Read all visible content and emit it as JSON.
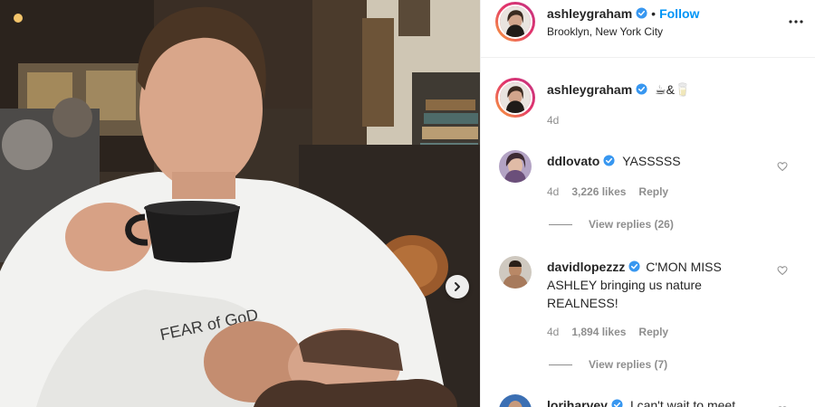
{
  "post": {
    "author": "ashleygraham",
    "follow_label": "Follow",
    "separator": "•",
    "location": "Brooklyn, New York City"
  },
  "caption": {
    "author": "ashleygraham",
    "text": "☕&🥛",
    "time": "4d"
  },
  "comments": [
    {
      "user": "ddlovato",
      "text": "YASSSSS",
      "time": "4d",
      "likes": "3,226 likes",
      "reply_label": "Reply",
      "view_replies": "View replies (26)"
    },
    {
      "user": "davidlopezzz",
      "text": "C'MON MISS ASHLEY bringing us nature REALNESS!",
      "time": "4d",
      "likes": "1,894 likes",
      "reply_label": "Reply",
      "view_replies": "View replies (7)"
    },
    {
      "user": "loriharvey",
      "text": "I can't wait to meet"
    }
  ],
  "colors": {
    "follow_blue": "#0095f6",
    "verified_blue": "#3897f0",
    "muted_text": "#8e8e8e",
    "divider": "#efefef"
  },
  "icons": {
    "more": "more-horizontal-icon",
    "heart": "heart-outline-icon",
    "verified": "verified-badge-icon",
    "next": "chevron-right-icon"
  }
}
